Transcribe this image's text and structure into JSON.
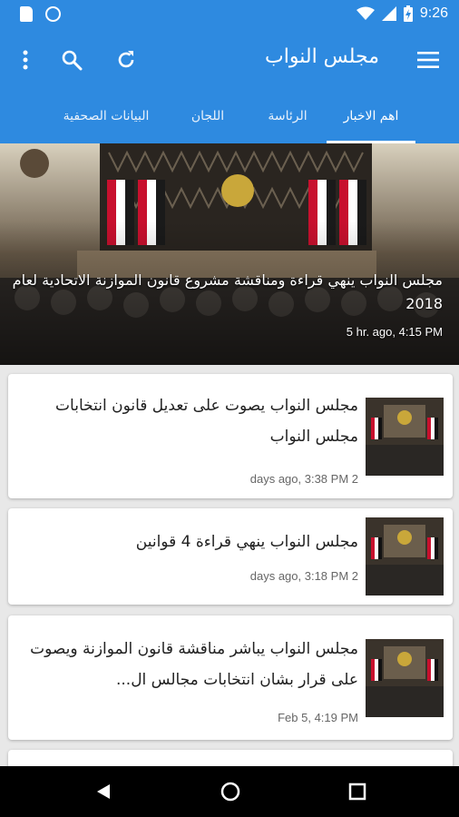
{
  "status_bar": {
    "time": "9:26",
    "icons": [
      "sd-card-icon",
      "circle-icon",
      "wifi-icon",
      "signal-icon",
      "battery-charging-icon"
    ]
  },
  "toolbar": {
    "title": "مجلس النواب",
    "icons": [
      "menu-icon",
      "refresh-icon",
      "search-icon",
      "more-vert-icon"
    ],
    "color": "#2e8ae0"
  },
  "tabs": [
    {
      "label": "اهم الاخبار",
      "active": true
    },
    {
      "label": "الرئاسة",
      "active": false
    },
    {
      "label": "اللجان",
      "active": false
    },
    {
      "label": "البيانات الصحفية",
      "active": false
    }
  ],
  "hero": {
    "headline": "مجلس النواب ينهي قراءة ومناقشة مشروع قانون الموازنة الاتحادية لعام 2018",
    "time": "5 hr. ago, 4:15 PM"
  },
  "news": [
    {
      "title": "مجلس النواب يصوت على تعديل قانون انتخابات مجلس النواب",
      "time": "days ago, 3:38 PM 2"
    },
    {
      "title": "مجلس النواب ينهي قراءة 4 قوانين",
      "time": "days ago, 3:18 PM 2"
    },
    {
      "title": "مجلس النواب يباشر مناقشة قانون الموازنة ويصوت على قرار بشان انتخابات مجالس ال...",
      "time": "Feb 5, 4:19 PM"
    }
  ],
  "nav_bar": {
    "icons": [
      "back-icon",
      "home-icon",
      "recents-icon"
    ]
  }
}
